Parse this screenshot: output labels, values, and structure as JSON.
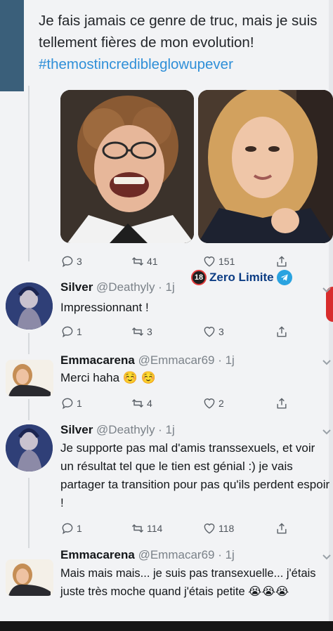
{
  "main_tweet": {
    "text": "Je fais jamais ce genre de truc, mais je suis tellement fières de mon evolution!",
    "hashtag": "#themostincredibleglowupever",
    "actions": {
      "replies": "3",
      "retweets": "41",
      "likes": "151"
    }
  },
  "watermark": {
    "badge": "18",
    "label": "Zero Limite"
  },
  "replies": [
    {
      "name": "Silver",
      "handle": "@Deathyly · 1j",
      "text": "Impressionnant !",
      "actions": {
        "replies": "1",
        "retweets": "3",
        "likes": "3"
      }
    },
    {
      "name": "Emmacarena",
      "handle": "@Emmacar69 · 1j",
      "text": "Merci haha ☺️ ☺️",
      "actions": {
        "replies": "1",
        "retweets": "4",
        "likes": "2"
      }
    },
    {
      "name": "Silver",
      "handle": "@Deathyly · 1j",
      "text": "Je supporte pas mal d'amis transsexuels, et voir un résultat tel que le tien est génial :) je vais partager ta transition pour pas qu'ils perdent espoir !",
      "actions": {
        "replies": "1",
        "retweets": "114",
        "likes": "118"
      }
    },
    {
      "name": "Emmacarena",
      "handle": "@Emmacar69 · 1j",
      "text": "Mais mais mais... je suis pas transexuelle... j'étais juste très moche quand j'étais petite 😭😭😭"
    }
  ],
  "colors": {
    "hashtag": "#2f8fd8",
    "name": "#14171a",
    "handle": "#7b8289",
    "badge_text": "#0d3d84"
  }
}
